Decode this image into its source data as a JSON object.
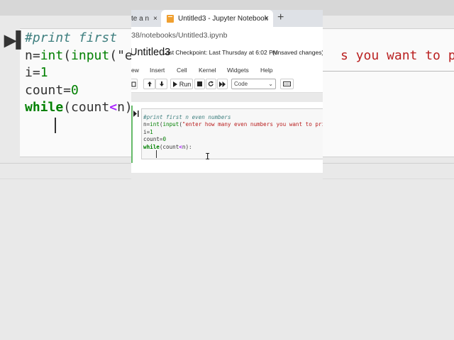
{
  "browser": {
    "prev_tab_title": "te a n",
    "active_tab_title": "Untitled3 - Jupyter Notebook",
    "new_tab_symbol": "+",
    "close_symbol": "×",
    "url": "38/notebooks/Untitled3.ipynb"
  },
  "notebook": {
    "title": "Untitled3",
    "checkpoint": "Last Checkpoint: Last Thursday at 6:02 PM",
    "save_status": "(unsaved changes)",
    "menu": [
      "ew",
      "Insert",
      "Cell",
      "Kernel",
      "Widgets",
      "Help"
    ],
    "toolbar": {
      "run_label": "Run",
      "cell_type": "Code"
    },
    "cell_code_lines": [
      "#print first n even numbers",
      "n=int(input(\"enter how many even numbers you want to print",
      "i=1",
      "count=0",
      "while(count<n):"
    ]
  },
  "background": {
    "right_fragment": "s you want to pri"
  }
}
